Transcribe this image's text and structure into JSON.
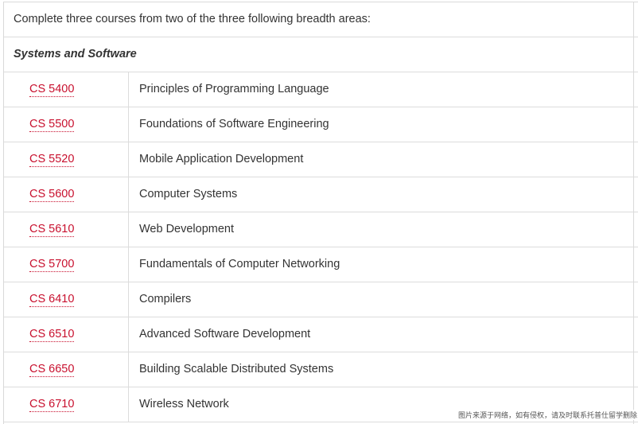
{
  "intro": "Complete three courses from two of the three following breadth areas:",
  "area": "Systems and Software",
  "courses": [
    {
      "code": "CS 5400",
      "title": "Principles of Programming Language"
    },
    {
      "code": "CS 5500",
      "title": "Foundations of Software Engineering"
    },
    {
      "code": "CS 5520",
      "title": "Mobile Application Development"
    },
    {
      "code": "CS 5600",
      "title": "Computer Systems"
    },
    {
      "code": "CS 5610",
      "title": "Web Development"
    },
    {
      "code": "CS 5700",
      "title": "Fundamentals of Computer Networking"
    },
    {
      "code": "CS 6410",
      "title": "Compilers"
    },
    {
      "code": "CS 6510",
      "title": "Advanced Software Development"
    },
    {
      "code": "CS 6650",
      "title": "Building Scalable Distributed Systems"
    },
    {
      "code": "CS 6710",
      "title": "Wireless Network"
    }
  ],
  "watermark": "图片来源于网络，如有侵权，请及时联系托普仕留学删除",
  "colors": {
    "link": "#c8102e",
    "border": "#dcdcdc",
    "text": "#333333"
  }
}
